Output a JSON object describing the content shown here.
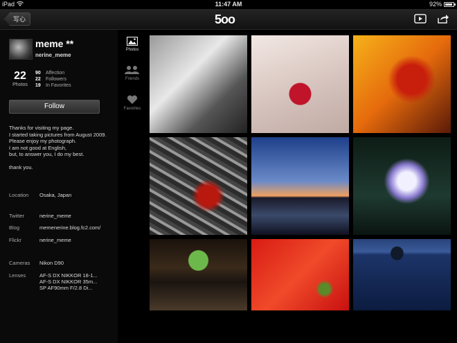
{
  "status_bar": {
    "device": "iPad",
    "time": "11:47 AM",
    "battery": "92%",
    "battery_level": 0.92
  },
  "nav": {
    "back_label": "写心",
    "logo": "5oo"
  },
  "profile": {
    "name": "meme **",
    "username": "nerine_meme",
    "photos_count": "22",
    "photos_label": "Photos",
    "stats": [
      {
        "num": "90",
        "label": "Affection"
      },
      {
        "num": "22",
        "label": "Followers"
      },
      {
        "num": "19",
        "label": "In Favorites"
      }
    ],
    "follow_label": "Follow",
    "bio": [
      "Thanks for visiting my page.",
      "I started taking pictures from August 2009.",
      "Please enjoy my photograph.",
      "I am not good at English,",
      "but, to answer you, I do my best.",
      "",
      "thank you."
    ],
    "location_label": "Location",
    "location": "Osaka, Japan",
    "twitter_label": "Twitter",
    "twitter": "nerine_meme",
    "blog_label": "Blog",
    "blog": "memenerine.blog.fc2.com/",
    "flickr_label": "Flickr",
    "flickr": "nerine_meme",
    "cameras_label": "Cameras",
    "cameras": "Nikon D90",
    "lenses_label": "Lenses",
    "lenses": [
      "AF-S DX NIKKOR 18-1...",
      "AF-S DX NIKKOR 35m...",
      "SP AF90mm F/2.8 Di..."
    ]
  },
  "tabs": [
    {
      "label": "Photos",
      "icon": "photo-icon",
      "active": true
    },
    {
      "label": "Friends",
      "icon": "people-icon",
      "active": false
    },
    {
      "label": "Favorites",
      "icon": "heart-icon",
      "active": false
    }
  ],
  "photos": [
    {
      "name": "photo-camera-portrait",
      "bg": "linear-gradient(135deg,#9a9a9a,#e8e8e8 40%,#555 70%,#222)"
    },
    {
      "name": "photo-red-heart-pendant",
      "bg": "radial-gradient(circle at 50% 60%,#c0142a 0 14%,transparent 15%),linear-gradient(160deg,#f2e8e4,#d9c6c0 50%,#bfa9a3)"
    },
    {
      "name": "photo-autumn-maple-leaves",
      "bg": "radial-gradient(circle at 60% 45%,#c81e0c 0 18%,transparent 30%),linear-gradient(135deg,#f6b21a,#e56a0c 50%,#5a1a08)"
    },
    {
      "name": "photo-maple-leaf-on-water",
      "bg": "radial-gradient(ellipse at 60% 60%,#b8180e 0 12%,transparent 20%),repeating-linear-gradient(30deg,#2c2c2c 0 6px,#9a9a9a 7px 10px,#444 11px 16px)"
    },
    {
      "name": "photo-river-sunset",
      "bg": "linear-gradient(#1e3f8a 0%,#6a8ac8 45%,#f0a060 60%,#1a1a2a 62%,#3a4a6a 80%,#101020)"
    },
    {
      "name": "photo-water-lily",
      "bg": "radial-gradient(circle at 55% 45%,#f0f0ff 0 12%,#8a7ad0 22%,transparent 30%),linear-gradient(#0d1c16,#1e3a30 60%,#0a1410)"
    },
    {
      "name": "photo-japanese-garden-view",
      "bg": "radial-gradient(ellipse at 50% 30%,#6cb84a 0 14%,transparent 15%),linear-gradient(#1a120c,#3a2a1a 40%,#1a1410 60%,#4a3a2a)"
    },
    {
      "name": "photo-red-autumn-blur",
      "bg": "radial-gradient(circle at 75% 70%,#5a8a2a 0 6%,transparent 10%),linear-gradient(135deg,#d81c14,#f04a2a 50%,#c81010)"
    },
    {
      "name": "photo-lake-island",
      "bg": "radial-gradient(ellipse at 45% 20%,#101a2a 0 8%,transparent 9%),linear-gradient(#28447a,#3a5a9a 18%,#1c3468 22%,#0c1c40)"
    }
  ]
}
